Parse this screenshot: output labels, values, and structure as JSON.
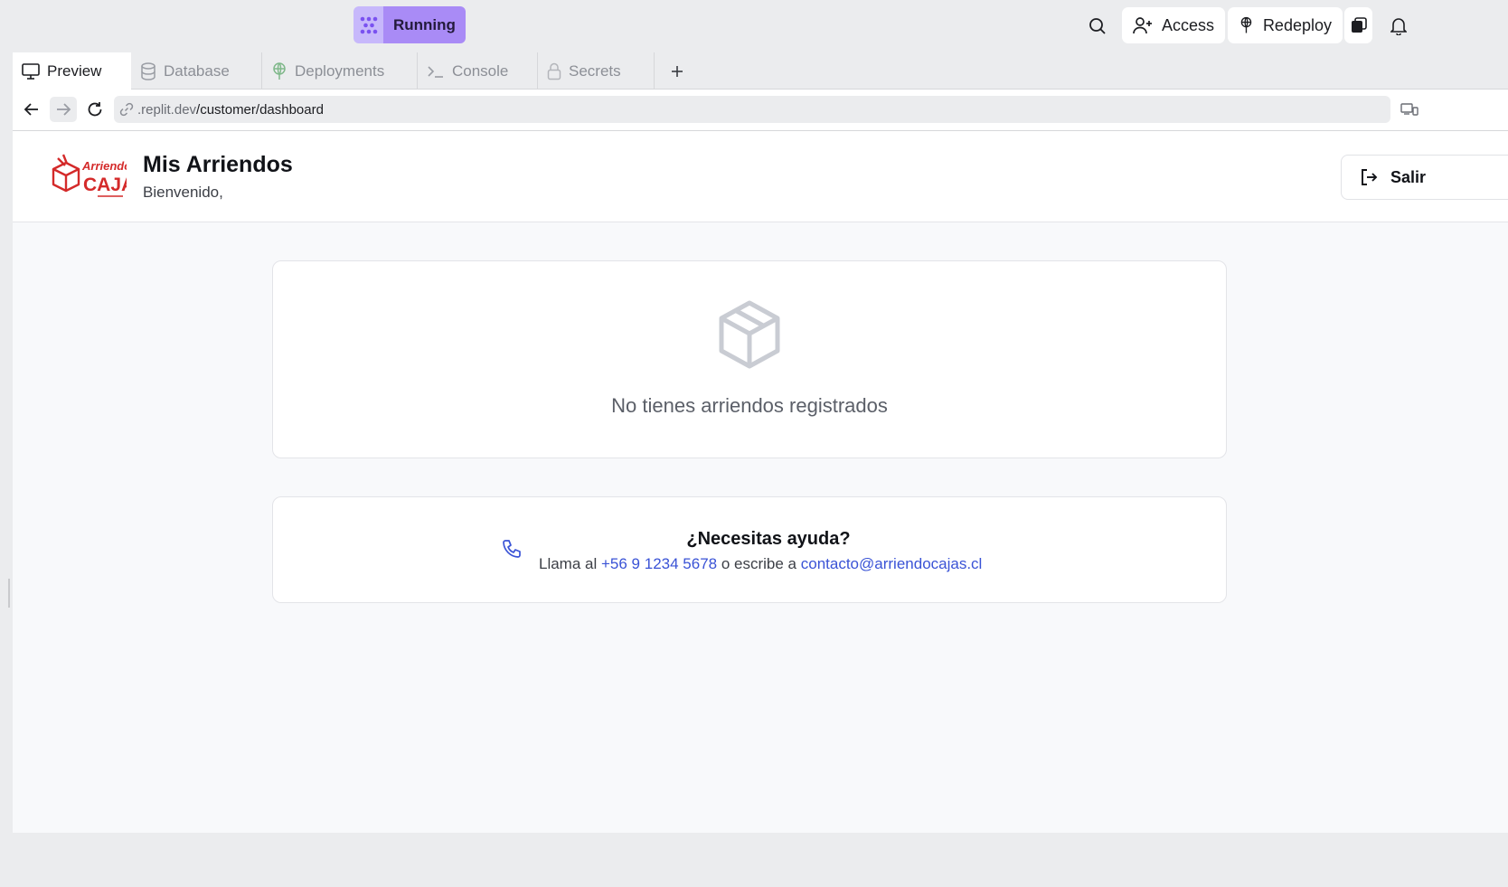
{
  "topbar": {
    "run_label": "Running",
    "access_label": "Access",
    "redeploy_label": "Redeploy"
  },
  "tabs": [
    {
      "label": "Preview",
      "icon": "monitor-icon",
      "active": true
    },
    {
      "label": "Database",
      "icon": "database-icon",
      "active": false
    },
    {
      "label": "Deployments",
      "icon": "deploy-icon",
      "active": false
    },
    {
      "label": "Console",
      "icon": "terminal-icon",
      "active": false
    },
    {
      "label": "Secrets",
      "icon": "lock-icon",
      "active": false
    }
  ],
  "address": {
    "domain": ".replit.dev",
    "path": "/customer/dashboard"
  },
  "app": {
    "logo_text_top": "Arriendo",
    "logo_text_bottom": "CAJAS",
    "title": "Mis Arriendos",
    "subtitle": "Bienvenido,",
    "logout_label": "Salir",
    "empty_message": "No tienes arriendos registrados",
    "help": {
      "title": "¿Necesitas ayuda?",
      "prefix": "Llama al",
      "phone": "+56 9 1234 5678",
      "middle": "o escribe a",
      "email": "contacto@arriendocajas.cl"
    }
  },
  "colors": {
    "accent_purple": "#a98bf6",
    "link_blue": "#3a53d6",
    "brand_red": "#d42a2a"
  }
}
